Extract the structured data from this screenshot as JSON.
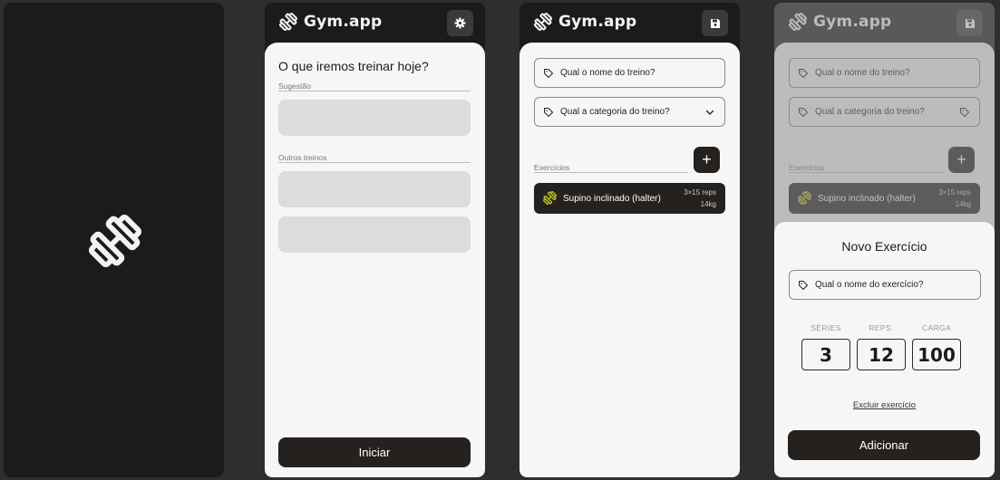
{
  "app": {
    "name": "Gym.app"
  },
  "home": {
    "question": "O que iremos treinar hoje?",
    "suggestion_label": "Sugestão",
    "other_label": "Outros treinos",
    "start_button": "Iniciar"
  },
  "editor": {
    "name_placeholder": "Qual o nome do treino?",
    "category_placeholder": "Qual a categoria do treino?",
    "exercises_label": "Exercícios",
    "add_symbol": "+",
    "exercises": [
      {
        "name": "Supino inclinado (halter)",
        "reps": "3×15 reps",
        "load": "14kg"
      }
    ]
  },
  "modal": {
    "title": "Novo Exercício",
    "name_placeholder": "Qual o nome do exercício?",
    "series_label": "SÉRIES",
    "reps_label": "REPS.",
    "load_label": "CARGA",
    "series_value": "3",
    "reps_value": "12",
    "load_value": "100",
    "delete_link": "Excluir exercício",
    "add_button": "Adicionar"
  },
  "icons": {
    "logo": "dumbbell-icon",
    "settings": "gear-icon",
    "save": "save-icon",
    "tag": "tag-icon",
    "dropdown": "chevron-down-icon"
  },
  "colors": {
    "dark": "#1b1c1a",
    "panel": "#f6f6f6",
    "accent_icon": "#b5b82a"
  }
}
